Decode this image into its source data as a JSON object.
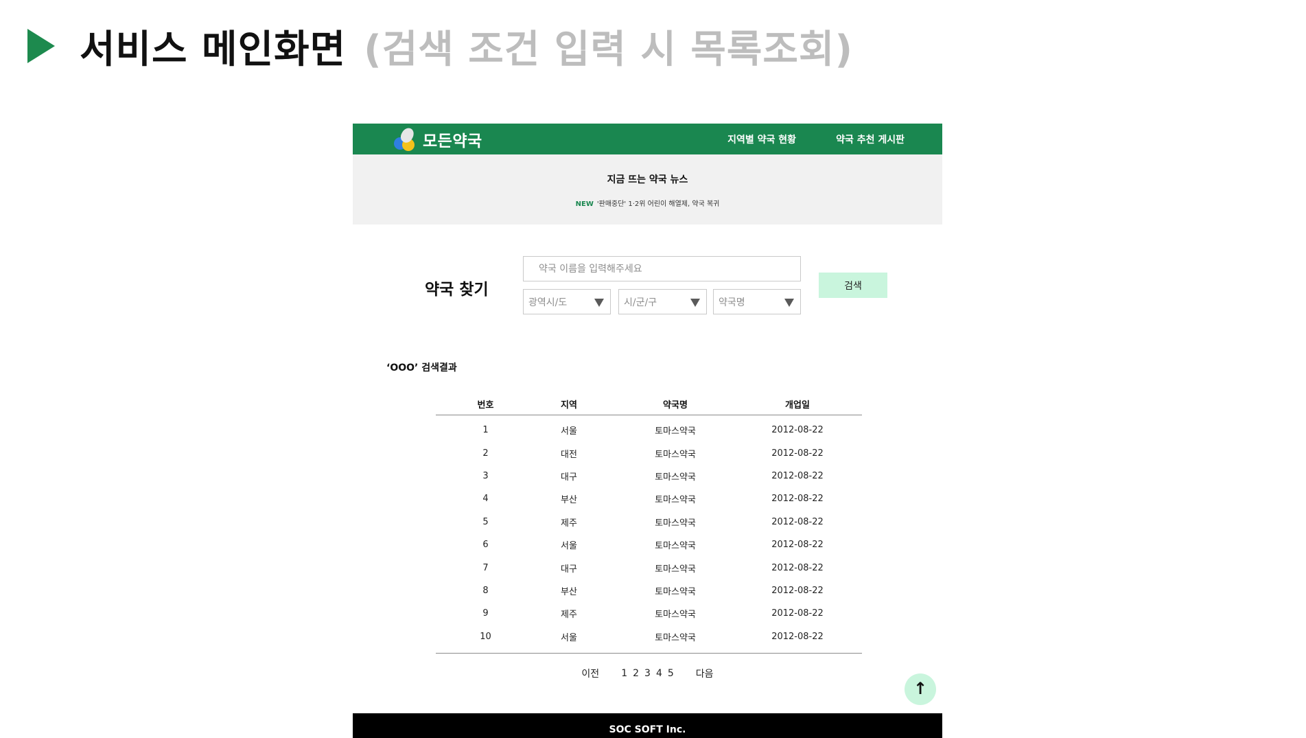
{
  "slide": {
    "title_main": "서비스 메인화면",
    "title_sub": "(검색 조건 입력 시 목록조회)",
    "bullet_icon": "play-triangle-icon",
    "accent_color": "#1d8a4e"
  },
  "site": {
    "logo_text": "모든약국",
    "logo_icon": "pill-bubbles-icon",
    "nav": [
      {
        "label": "지역별 약국 현황"
      },
      {
        "label": "약국 추천 게시판"
      }
    ],
    "header_color": "#1a8750"
  },
  "news": {
    "title": "지금 뜨는 약국 뉴스",
    "badge": "NEW",
    "headline": "'판매중단' 1·2위 어린이 해열제, 약국 복귀"
  },
  "search": {
    "title": "약국 찾기",
    "placeholder": "약국 이름을 입력해주세요",
    "selects": [
      {
        "value": "광역시/도"
      },
      {
        "value": "시/군/구"
      },
      {
        "value": "약국명"
      }
    ],
    "button_label": "검색",
    "button_color": "#c9f5dd"
  },
  "results": {
    "caption": "‘OOO’ 검색결과",
    "columns": [
      "번호",
      "지역",
      "약국명",
      "개업일"
    ],
    "rows": [
      [
        "1",
        "서울",
        "토마스약국",
        "2012-08-22"
      ],
      [
        "2",
        "대전",
        "토마스약국",
        "2012-08-22"
      ],
      [
        "3",
        "대구",
        "토마스약국",
        "2012-08-22"
      ],
      [
        "4",
        "부산",
        "토마스약국",
        "2012-08-22"
      ],
      [
        "5",
        "제주",
        "토마스약국",
        "2012-08-22"
      ],
      [
        "6",
        "서울",
        "토마스약국",
        "2012-08-22"
      ],
      [
        "7",
        "대구",
        "토마스약국",
        "2012-08-22"
      ],
      [
        "8",
        "부산",
        "토마스약국",
        "2012-08-22"
      ],
      [
        "9",
        "제주",
        "토마스약국",
        "2012-08-22"
      ],
      [
        "10",
        "서울",
        "토마스약국",
        "2012-08-22"
      ]
    ]
  },
  "pagination": {
    "prev": "이전",
    "pages": [
      "1",
      "2",
      "3",
      "4",
      "5"
    ],
    "next": "다음"
  },
  "top_button": {
    "icon": "arrow-up-icon",
    "glyph": "↑"
  },
  "footer": {
    "text": "SOC SOFT Inc."
  }
}
